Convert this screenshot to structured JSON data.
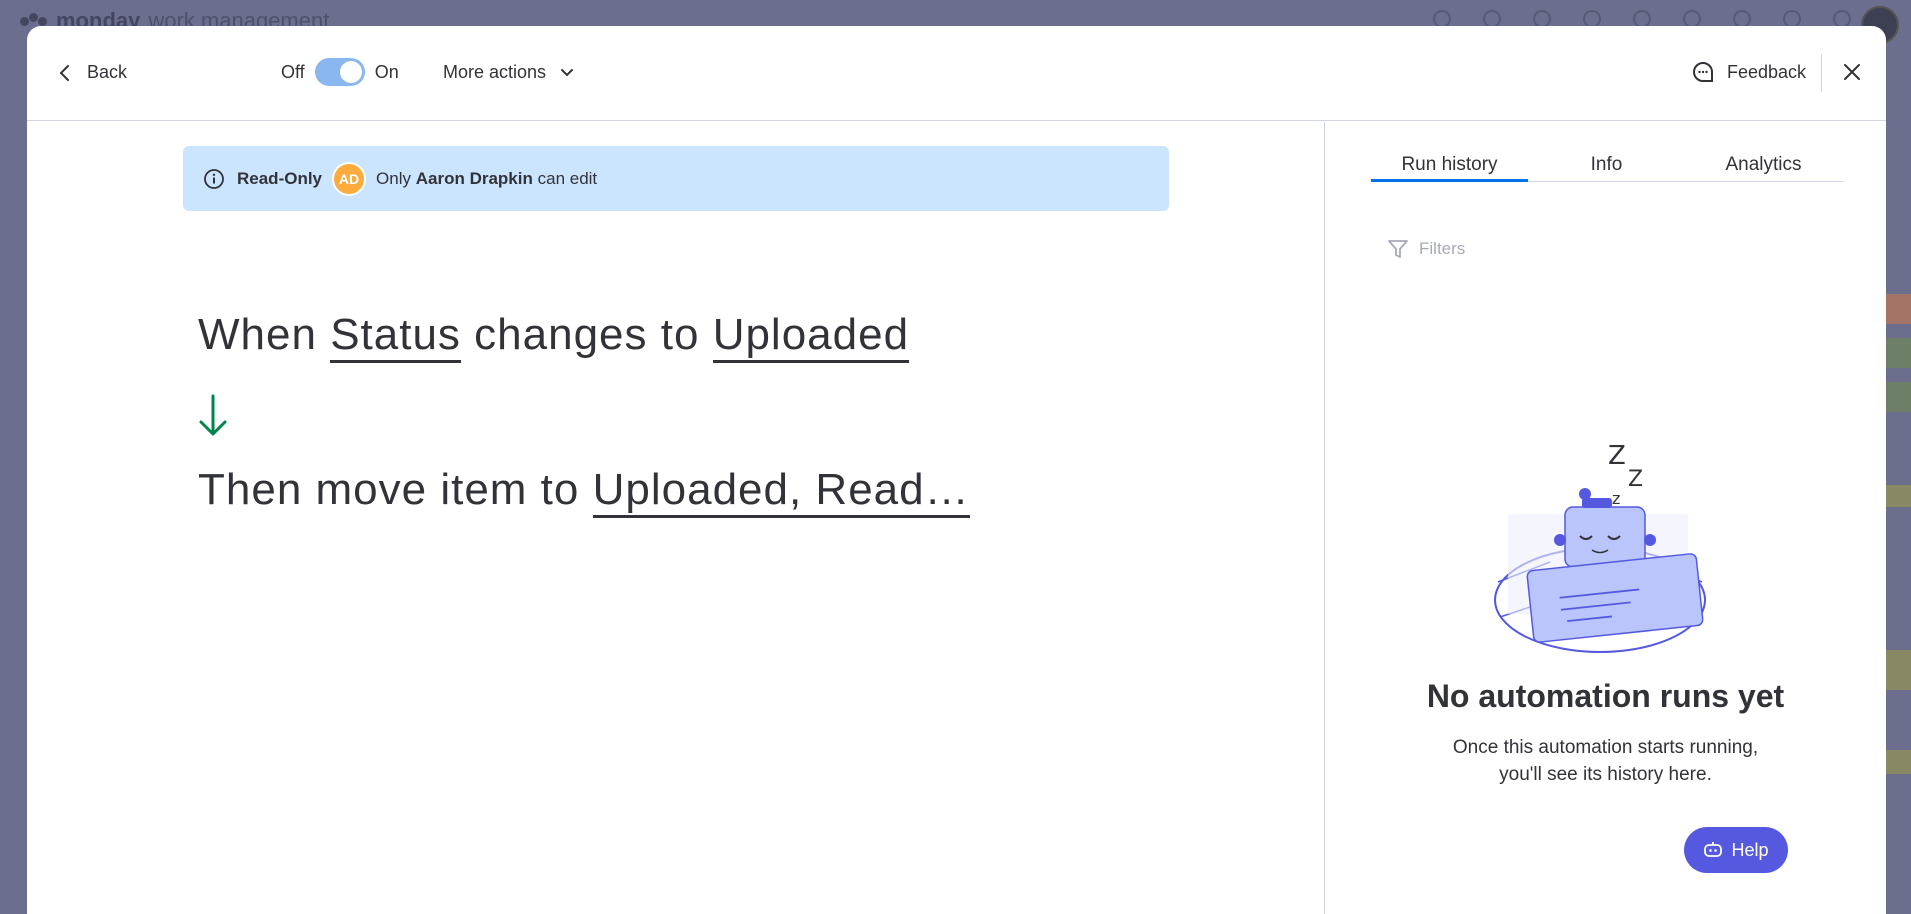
{
  "background": {
    "logo_bold": "monday",
    "logo_light": "work management"
  },
  "header": {
    "back_label": "Back",
    "toggle_off_label": "Off",
    "toggle_on_label": "On",
    "more_actions_label": "More actions",
    "feedback_label": "Feedback"
  },
  "banner": {
    "readonly_label": "Read-Only",
    "avatar_initials": "AD",
    "text_prefix": "Only",
    "user_name": "Aaron Drapkin",
    "text_suffix": "can edit"
  },
  "recipe": {
    "trigger_when": "When",
    "trigger_column": "Status",
    "trigger_changes": "changes to",
    "trigger_value": "Uploaded",
    "action_prefix": "Then move item to",
    "action_target": "Uploaded, Read…"
  },
  "side_panel": {
    "tabs": [
      {
        "label": "Run history",
        "active": true
      },
      {
        "label": "Info",
        "active": false
      },
      {
        "label": "Analytics",
        "active": false
      }
    ],
    "filters_label": "Filters",
    "empty_title": "No automation runs yet",
    "empty_line1": "Once this automation starts running,",
    "empty_line2": "you'll see its history here."
  },
  "help_label": "Help",
  "colors": {
    "accent": "#0073ea",
    "banner_bg": "#cce5ff",
    "toggle_bg": "#8bb7ef",
    "avatar_bg": "#fdab3d",
    "arrow": "#00854d",
    "help_bg": "#5559df"
  },
  "icons": {
    "back": "chevron-left-icon",
    "more": "chevron-down-icon",
    "feedback": "feedback-bubble-icon",
    "close": "close-icon",
    "info": "info-icon",
    "arrow": "arrow-down-icon",
    "filter": "filter-icon",
    "help": "help-bot-icon"
  }
}
